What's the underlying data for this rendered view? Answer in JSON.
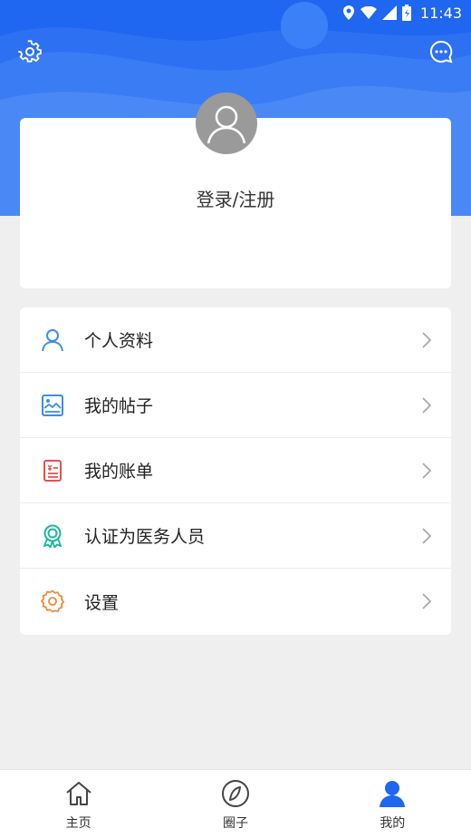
{
  "status_bar": {
    "time": "11:43"
  },
  "header": {
    "settings_icon": "gear-icon",
    "message_icon": "chat-bubble-icon"
  },
  "login_card": {
    "label": "登录/注册"
  },
  "menu": {
    "items": [
      {
        "label": "个人资料",
        "icon": "person-icon",
        "color": "#3a8ee6"
      },
      {
        "label": "我的帖子",
        "icon": "picture-icon",
        "color": "#3a8ee6"
      },
      {
        "label": "我的账单",
        "icon": "bill-icon",
        "color": "#e65050"
      },
      {
        "label": "认证为医务人员",
        "icon": "badge-icon",
        "color": "#1bb89a"
      },
      {
        "label": "设置",
        "icon": "gear-icon",
        "color": "#f08a3c"
      }
    ]
  },
  "tabbar": {
    "tabs": [
      {
        "label": "主页",
        "icon": "home-icon"
      },
      {
        "label": "圈子",
        "icon": "compass-icon"
      },
      {
        "label": "我的",
        "icon": "user-icon",
        "active": true
      }
    ]
  },
  "colors": {
    "primary": "#1f66f0",
    "active_tab": "#1f66f0"
  }
}
